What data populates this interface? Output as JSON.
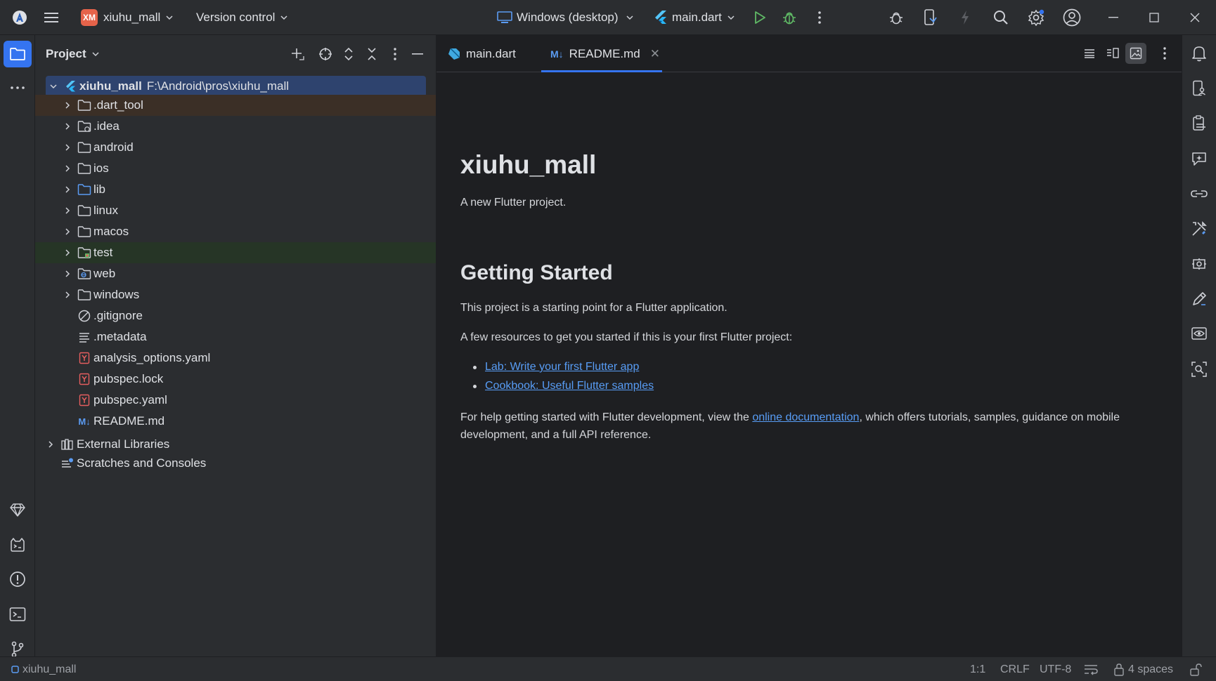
{
  "titlebar": {
    "project_initials": "XM",
    "project_name": "xiuhu_mall",
    "version_control": "Version control",
    "device": "Windows (desktop)",
    "run_config": "main.dart"
  },
  "project_panel": {
    "title": "Project",
    "root": {
      "name": "xiuhu_mall",
      "path": "F:\\Android\\pros\\xiuhu_mall"
    },
    "items": [
      {
        "label": ".dart_tool",
        "icon": "folder-icon"
      },
      {
        "label": ".idea",
        "icon": "folder-settings-icon"
      },
      {
        "label": "android",
        "icon": "folder-icon"
      },
      {
        "label": "ios",
        "icon": "folder-icon"
      },
      {
        "label": "lib",
        "icon": "source-folder-icon"
      },
      {
        "label": "linux",
        "icon": "folder-icon"
      },
      {
        "label": "macos",
        "icon": "folder-icon"
      },
      {
        "label": "test",
        "icon": "test-folder-icon"
      },
      {
        "label": "web",
        "icon": "web-folder-icon"
      },
      {
        "label": "windows",
        "icon": "folder-icon"
      },
      {
        "label": ".gitignore",
        "icon": "ignore-file-icon"
      },
      {
        "label": ".metadata",
        "icon": "text-file-icon"
      },
      {
        "label": "analysis_options.yaml",
        "icon": "yaml-file-icon"
      },
      {
        "label": "pubspec.lock",
        "icon": "yaml-file-icon"
      },
      {
        "label": "pubspec.yaml",
        "icon": "yaml-file-icon"
      },
      {
        "label": "README.md",
        "icon": "markdown-file-icon"
      }
    ],
    "external_libraries": "External Libraries",
    "scratches": "Scratches and Consoles"
  },
  "editor": {
    "tabs": [
      {
        "label": "main.dart",
        "icon": "dart-icon"
      },
      {
        "label": "README.md",
        "icon": "markdown-icon",
        "active": true
      }
    ],
    "markdown": {
      "h1": "xiuhu_mall",
      "intro": "A new Flutter project.",
      "h2": "Getting Started",
      "p1": "This project is a starting point for a Flutter application.",
      "p2": "A few resources to get you started if this is your first Flutter project:",
      "links": [
        "Lab: Write your first Flutter app",
        "Cookbook: Useful Flutter samples"
      ],
      "p3_before": "For help getting started with Flutter development, view the ",
      "p3_link": "online documentation",
      "p3_after": ", which offers tutorials, samples, guidance on mobile development, and a full API reference."
    }
  },
  "statusbar": {
    "project": "xiuhu_mall",
    "position": "1:1",
    "line_separator": "CRLF",
    "encoding": "UTF-8",
    "indent": "4 spaces"
  },
  "colors": {
    "accent": "#3574f0",
    "link": "#589df6",
    "run_green": "#5fb865",
    "project_badge": "#e5634a",
    "yaml_red": "#e55e5e",
    "panel_bg": "#2b2d30",
    "editor_bg": "#1e1f22"
  }
}
